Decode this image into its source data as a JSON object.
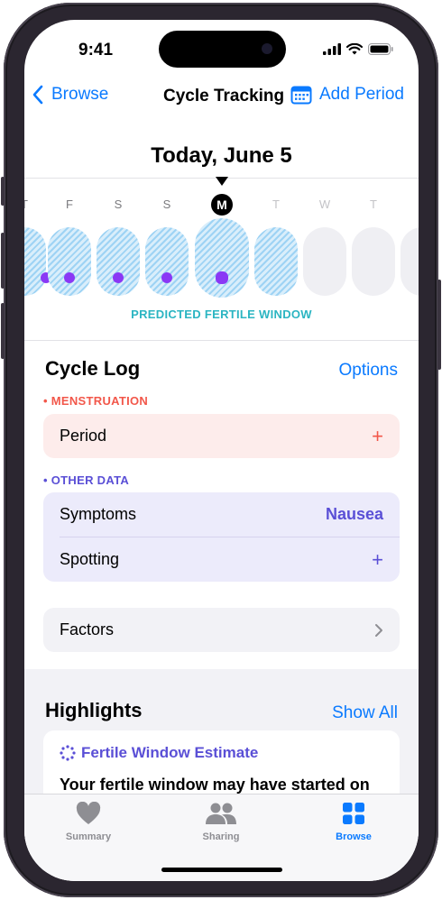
{
  "status_bar": {
    "time": "9:41"
  },
  "nav": {
    "back_label": "Browse",
    "title": "Cycle Tracking",
    "add_label": "Add Period"
  },
  "calendar": {
    "date_title": "Today, June 5",
    "days": [
      "T",
      "F",
      "S",
      "S",
      "M",
      "T",
      "W",
      "T"
    ],
    "fertile_window_label": "PREDICTED FERTILE WINDOW"
  },
  "cycle_log": {
    "title": "Cycle Log",
    "options_label": "Options",
    "menstruation": {
      "label": "• MENSTRUATION",
      "rows": [
        {
          "label": "Period",
          "action": "+"
        }
      ]
    },
    "other_data": {
      "label": "• OTHER DATA",
      "rows": [
        {
          "label": "Symptoms",
          "value": "Nausea"
        },
        {
          "label": "Spotting",
          "action": "+"
        }
      ]
    },
    "factors": {
      "label": "Factors",
      "chevron": "›"
    }
  },
  "highlights": {
    "title": "Highlights",
    "show_all_label": "Show All",
    "card": {
      "heading": "Fertile Window Estimate",
      "text": "Your fertile window may have started on"
    }
  },
  "tab_bar": {
    "tabs": [
      {
        "label": "Summary"
      },
      {
        "label": "Sharing"
      },
      {
        "label": "Browse"
      }
    ],
    "active": "Browse"
  },
  "colors": {
    "accent": "#0a7aff",
    "menstruation": "#f2574a",
    "other_data": "#5a4fd6",
    "fertile": "#2bb5c2",
    "ovulation_dot": "#8a38f5"
  },
  "icons": {
    "back": "chevron-left-icon",
    "calendar": "calendar-icon",
    "add": "plus-icon",
    "chevron": "chevron-right-icon",
    "fertile": "dotted-circle-icon",
    "summary": "heart-icon",
    "sharing": "people-icon",
    "browse": "grid-icon"
  }
}
